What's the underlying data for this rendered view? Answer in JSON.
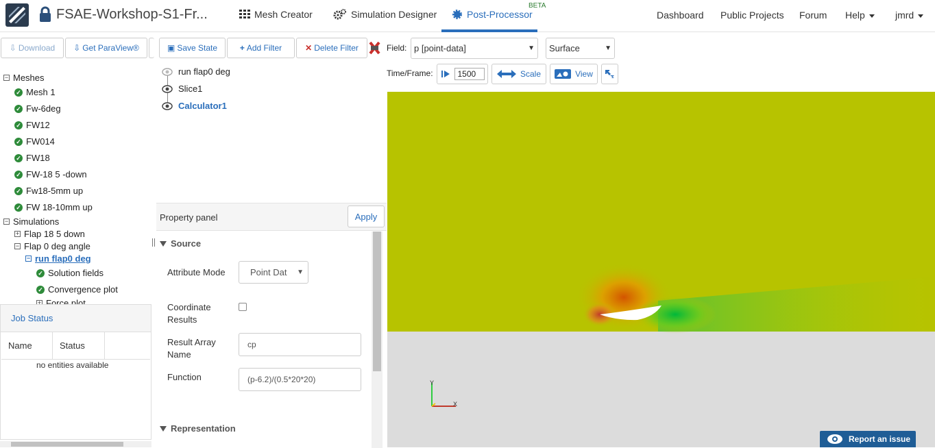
{
  "header": {
    "project_title": "FSAE-Workshop-S1-Fr...",
    "tabs": [
      {
        "label": "Mesh Creator",
        "icon": "grid-icon"
      },
      {
        "label": "Simulation Designer",
        "icon": "gears-icon"
      },
      {
        "label": "Post-Processor",
        "icon": "gear-blue-icon",
        "badge": "BETA",
        "active": true
      }
    ],
    "links": {
      "dashboard": "Dashboard",
      "public_projects": "Public Projects",
      "forum": "Forum",
      "help": "Help",
      "user": "jmrd"
    }
  },
  "left_toolbar": {
    "download": "Download",
    "get_paraview": "Get ParaView®"
  },
  "tree": {
    "meshes_label": "Meshes",
    "meshes": [
      "Mesh 1",
      "Fw-6deg",
      "FW12",
      "FW014",
      "FW18",
      "FW-18 5 -down",
      "Fw18-5mm up",
      "FW 18-10mm up"
    ],
    "simulations_label": "Simulations",
    "simulations": [
      "Flap 18 5 down",
      "Flap 0 deg angle"
    ],
    "run_label": "run flap0 deg",
    "run_children": [
      "Solution fields",
      "Convergence plot",
      "Force plot"
    ]
  },
  "job_status": {
    "title": "Job Status",
    "columns": [
      "Name",
      "Status"
    ],
    "empty_text": "no entities available"
  },
  "pipeline_toolbar": {
    "save_state": "Save State",
    "add_filter": "Add Filter",
    "delete_filter": "Delete Filter"
  },
  "pipeline": [
    "run flap0 deg",
    "Slice1",
    "Calculator1"
  ],
  "property_panel": {
    "title": "Property panel",
    "apply": "Apply",
    "source_section": "Source",
    "attribute_mode_label": "Attribute Mode",
    "attribute_mode_value": "Point Dat",
    "coordinate_results_label": "Coordinate Results",
    "result_array_label": "Result Array Name",
    "result_array_value": "cp",
    "function_label": "Function",
    "function_value": "(p-6.2)/(0.5*20*20)",
    "representation_section": "Representation"
  },
  "viewer": {
    "field_label": "Field:",
    "field_value": "p [point-data]",
    "representation_value": "Surface",
    "time_label": "Time/Frame:",
    "frame_value": "1500",
    "scale_label": "Scale",
    "view_label": "View",
    "axis_y": "Y",
    "axis_x": "X"
  },
  "report_issue": "Report an issue",
  "colors": {
    "accent": "#2a6ebb",
    "success": "#2e8b3a",
    "delete": "#c9302c",
    "field_background": "#b7c300",
    "ground": "#dcdcdc"
  }
}
